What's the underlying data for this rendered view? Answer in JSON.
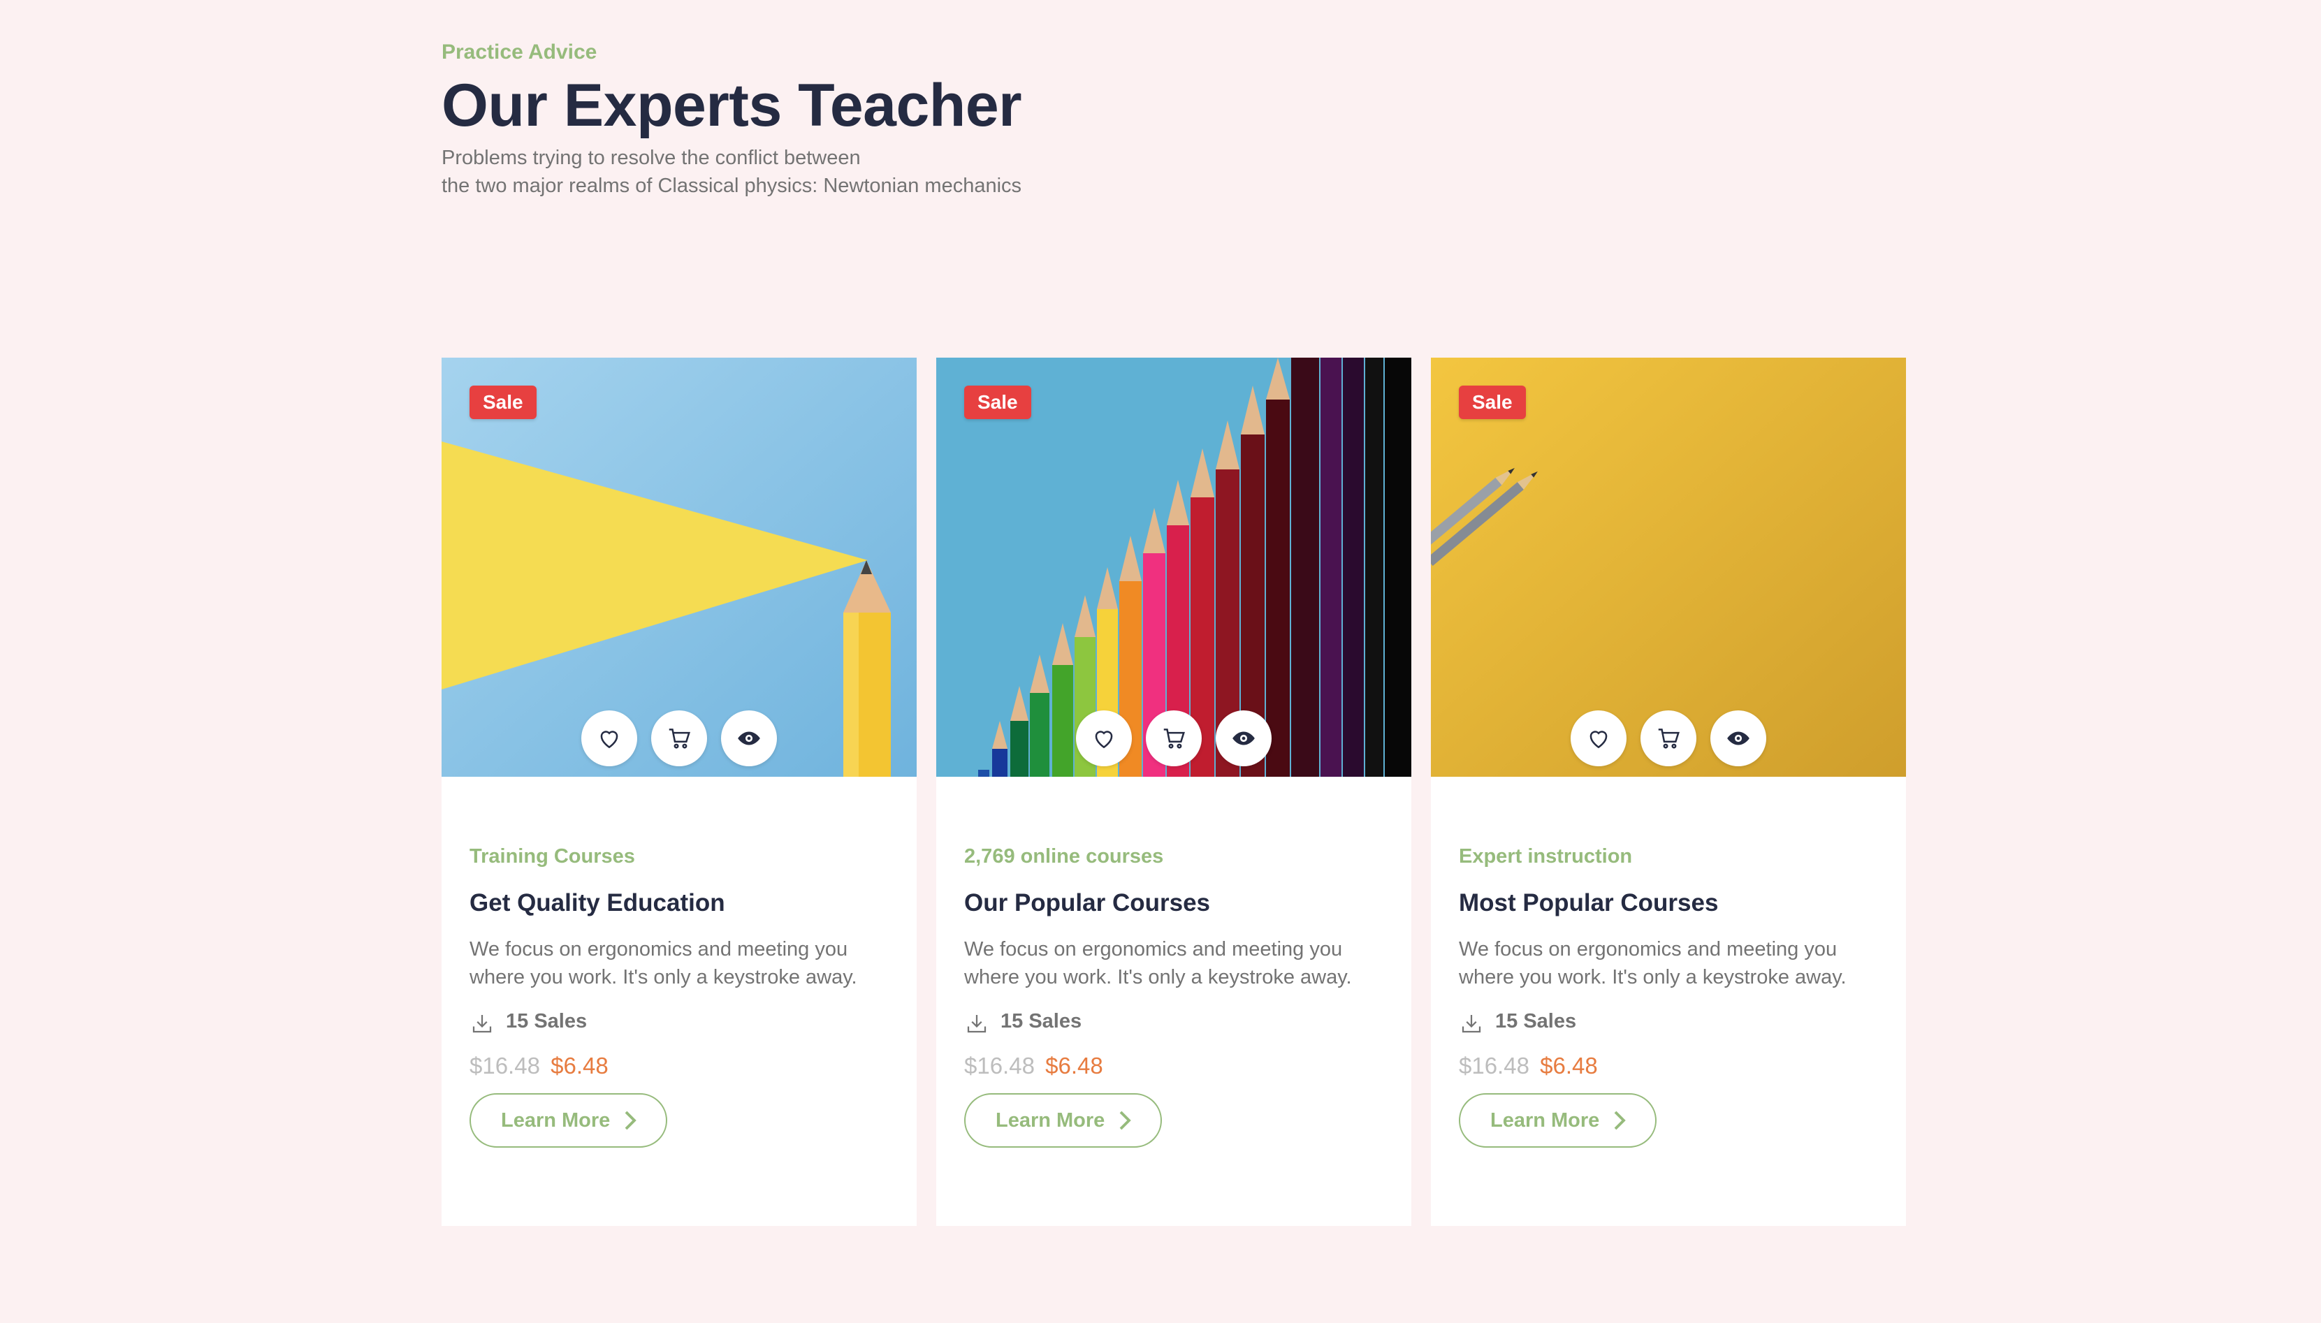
{
  "section": {
    "eyebrow": "Practice Advice",
    "title": "Our Experts Teacher",
    "subtitle_line1": "Problems trying to resolve the conflict between",
    "subtitle_line2": "the two major realms of Classical physics: Newtonian mechanics"
  },
  "colors": {
    "accent_green": "#96bb7c",
    "sale_red": "#e74040",
    "price_orange": "#e77c40",
    "heading_dark": "#252b42",
    "text_gray": "#737373",
    "background": "#fcf1f2"
  },
  "icons": {
    "favorite": "heart-icon",
    "cart": "cart-icon",
    "preview": "eye-icon",
    "sales": "download-icon",
    "learn_more": "chevron-right-icon"
  },
  "cards": [
    {
      "badge": "Sale",
      "tag": "Training Courses",
      "title": "Get Quality Education",
      "description": "We focus on ergonomics and meeting you where you work. It's only a keystroke away.",
      "sales": "15 Sales",
      "old_price": "$16.48",
      "new_price": "$6.48",
      "cta": "Learn More"
    },
    {
      "badge": "Sale",
      "tag": "2,769 online courses",
      "title": "Our Popular Courses",
      "description": "We focus on ergonomics and meeting you where you work. It's only a keystroke away.",
      "sales": "15 Sales",
      "old_price": "$16.48",
      "new_price": "$6.48",
      "cta": "Learn More"
    },
    {
      "badge": "Sale",
      "tag": "Expert instruction",
      "title": "Most Popular Courses",
      "description": "We focus on ergonomics and meeting you where you work. It's only a keystroke away.",
      "sales": "15 Sales",
      "old_price": "$16.48",
      "new_price": "$6.48",
      "cta": "Learn More"
    }
  ]
}
